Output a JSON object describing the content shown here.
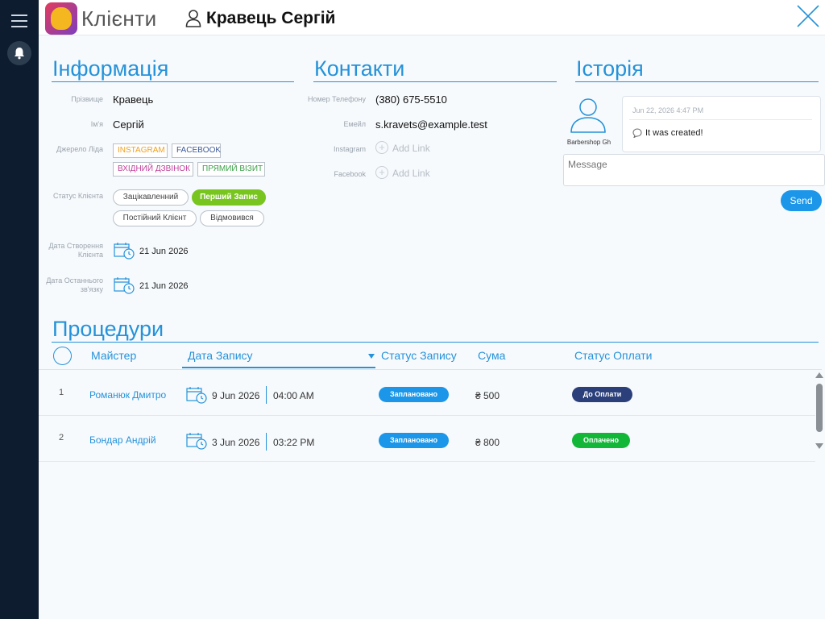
{
  "app": {
    "title": "Клієнти"
  },
  "client": {
    "name": "Кравець Сергій"
  },
  "sections": {
    "info": "Інформація",
    "contacts": "Контакти",
    "history": "Історія",
    "procedures": "Процедури"
  },
  "info": {
    "surname_label": "Прізвище",
    "surname": "Кравець",
    "name_label": "Ім'я",
    "name": "Сергій",
    "source_label": "Джерело Ліда",
    "sources": [
      {
        "label": "INSTAGRAM",
        "color": "#f0a020"
      },
      {
        "label": "FACEBOOK",
        "color": "#3b5998"
      },
      {
        "label": "ВХІДНИЙ ДЗВІНОК",
        "color": "#c0409a"
      },
      {
        "label": "ПРЯМИЙ ВІЗИТ",
        "color": "#3aa048"
      }
    ],
    "status_label": "Статус Клієнта",
    "statuses": [
      "Зацікавленний",
      "Перший Запис",
      "Постійний Клієнт",
      "Відмовився"
    ],
    "active_status": "Перший Запис",
    "created_label": "Дата Створення Клієнта",
    "created": "21 Jun 2026",
    "last_contact_label": "Дата Останнього зв'язку",
    "last_contact": "21 Jun 2026"
  },
  "contacts": {
    "phone_label": "Номер Телефону",
    "phone": "(380) 675-5510",
    "email_label": "Емейл",
    "email": "s.kravets@example.test",
    "instagram_label": "Instagram",
    "facebook_label": "Facebook",
    "add_link": "Add Link"
  },
  "history": {
    "user": "Barbershop Gh",
    "time": "Jun 22, 2026 4:47 PM",
    "message": "It was created!",
    "input_placeholder": "Message",
    "send": "Send"
  },
  "table": {
    "headers": {
      "master": "Майстер",
      "date": "Дата Запису",
      "status": "Статус Запису",
      "sum": "Сума",
      "payment": "Статус Оплати"
    },
    "rows": [
      {
        "num": "1",
        "master": "Романюк Дмитро",
        "date": "9 Jun 2026",
        "time": "04:00 AM",
        "status": "Заплановано",
        "sum": "₴ 500",
        "payment": "До Оплати",
        "payment_color": "#2b3f7a"
      },
      {
        "num": "2",
        "master": "Бондар Андрій",
        "date": "3 Jun 2026",
        "time": "03:22 PM",
        "status": "Заплановано",
        "sum": "₴ 800",
        "payment": "Оплачено",
        "payment_color": "#12b738"
      }
    ],
    "status_color": "#1b96e8"
  }
}
